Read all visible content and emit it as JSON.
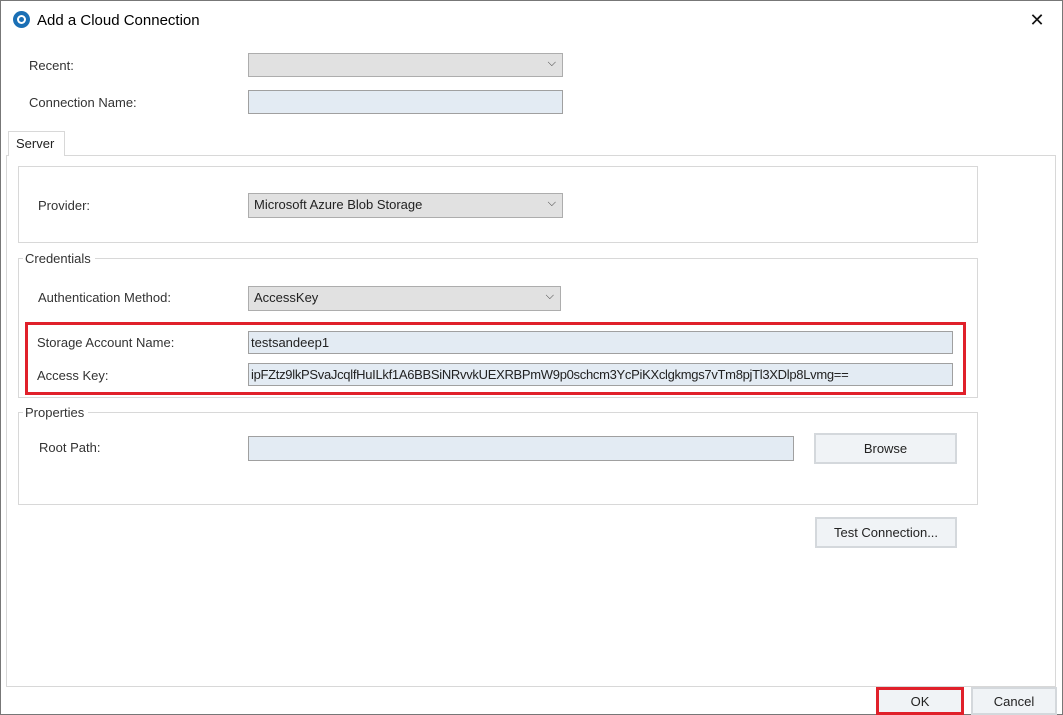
{
  "window": {
    "title": "Add a Cloud Connection",
    "close_icon": "close-icon"
  },
  "form": {
    "recent_label": "Recent:",
    "recent_value": "",
    "connection_name_label": "Connection Name:",
    "connection_name_value": ""
  },
  "tabs": [
    {
      "label": "Server"
    }
  ],
  "server": {
    "provider_label": "Provider:",
    "provider_value": "Microsoft Azure Blob Storage",
    "credentials_title": "Credentials",
    "auth_method_label": "Authentication Method:",
    "auth_method_value": "AccessKey",
    "storage_account_label": "Storage Account Name:",
    "storage_account_value": "testsandeep1",
    "access_key_label": "Access Key:",
    "access_key_value": "ipFZtz9lkPSvaJcqlfHuILkf1A6BBSiNRvvkUEXRBPmW9p0schcm3YcPiKXclgkmgs7vTm8pjTl3XDlp8Lvmg==",
    "properties_title": "Properties",
    "root_path_label": "Root Path:",
    "root_path_value": "",
    "browse_label": "Browse",
    "test_connection_label": "Test Connection..."
  },
  "footer": {
    "ok_label": "OK",
    "cancel_label": "Cancel"
  },
  "colors": {
    "highlight": "#e0202a",
    "input_bg": "#e3ebf3"
  }
}
